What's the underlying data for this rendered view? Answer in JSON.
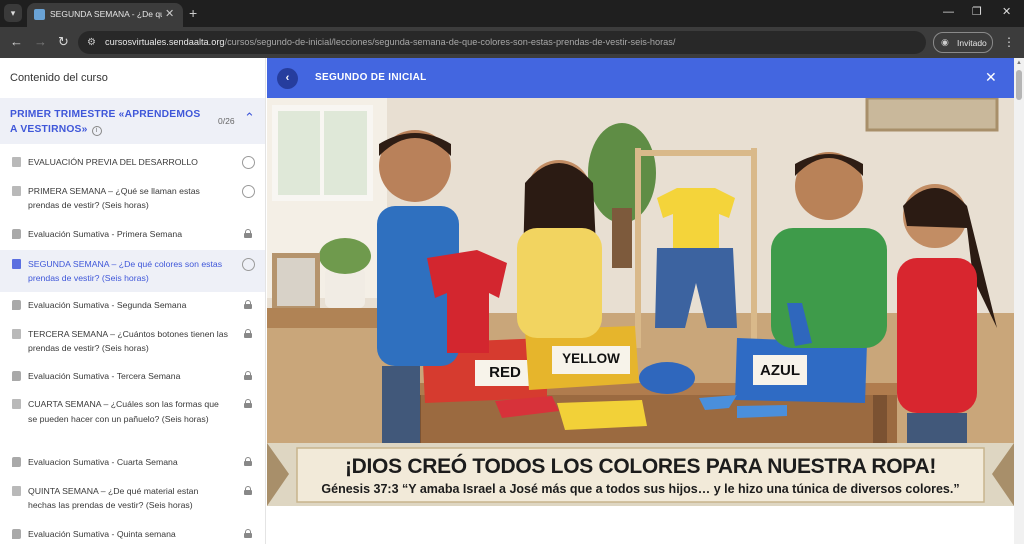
{
  "browser": {
    "tab_title": "SEGUNDA SEMANA - ¿De qué c",
    "url_host": "cursosvirtuales.sendaalta.org",
    "url_path": "/cursos/segundo-de-inicial/lecciones/segunda-semana-de-que-colores-son-estas-prendas-de-vestir-seis-horas/",
    "profile_label": "Invitado"
  },
  "sidebar": {
    "header": "Contenido del curso",
    "section": {
      "title": "PRIMER TRIMESTRE «APRENDEMOS A VESTIRNOS»",
      "count": "0/26"
    },
    "lessons": [
      {
        "label": "EVALUACIÓN PREVIA DEL DESARROLLO",
        "status": "open",
        "icon": "document-icon"
      },
      {
        "label": "PRIMERA SEMANA – ¿Qué se llaman estas prendas de vestir? (Seis horas)",
        "status": "open",
        "icon": "document-icon"
      },
      {
        "label": "Evaluación Sumativa - Primera Semana",
        "status": "locked",
        "icon": "quiz-icon"
      },
      {
        "label": "SEGUNDA SEMANA – ¿De qué colores son estas prendas de vestir? (Seis horas)",
        "status": "open",
        "icon": "document-icon",
        "active": true
      },
      {
        "label": "Evaluación Sumativa - Segunda Semana",
        "status": "locked",
        "icon": "quiz-icon"
      },
      {
        "label": "TERCERA SEMANA – ¿Cuántos botones tienen las prendas de vestir? (Seis horas)",
        "status": "locked",
        "icon": "document-icon"
      },
      {
        "label": "Evaluación Sumativa - Tercera Semana",
        "status": "locked",
        "icon": "quiz-icon"
      },
      {
        "label": "CUARTA SEMANA – ¿Cuáles son las formas que se pueden hacer con un pañuelo? (Seis horas)",
        "status": "locked",
        "icon": "document-icon"
      },
      {
        "label": "Evaluacion Sumativa - Cuarta Semana",
        "status": "locked",
        "icon": "quiz-icon"
      },
      {
        "label": "QUINTA SEMANA – ¿De qué material estan hechas las prendas de vestir? (Seis horas)",
        "status": "locked",
        "icon": "document-icon"
      },
      {
        "label": "Evaluación Sumativa - Quinta semana",
        "status": "locked",
        "icon": "quiz-icon"
      }
    ]
  },
  "main": {
    "heading": "SEGUNDO DE INICIAL",
    "image": {
      "box_labels": [
        "RED",
        "YELLOW",
        "AZUL"
      ],
      "headline": "¡DIOS CREÓ TODOS LOS COLORES PARA NUESTRA ROPA!",
      "verse": "Génesis 37:3 “Y amaba Israel a José más que a todos sus hijos… y le hizo una túnica de diversos colores.”"
    }
  },
  "colors": {
    "accent": "#4366e0",
    "accent_dark": "#263d9e",
    "active_bg": "#eef0f7",
    "section_title": "#3f57d9"
  }
}
